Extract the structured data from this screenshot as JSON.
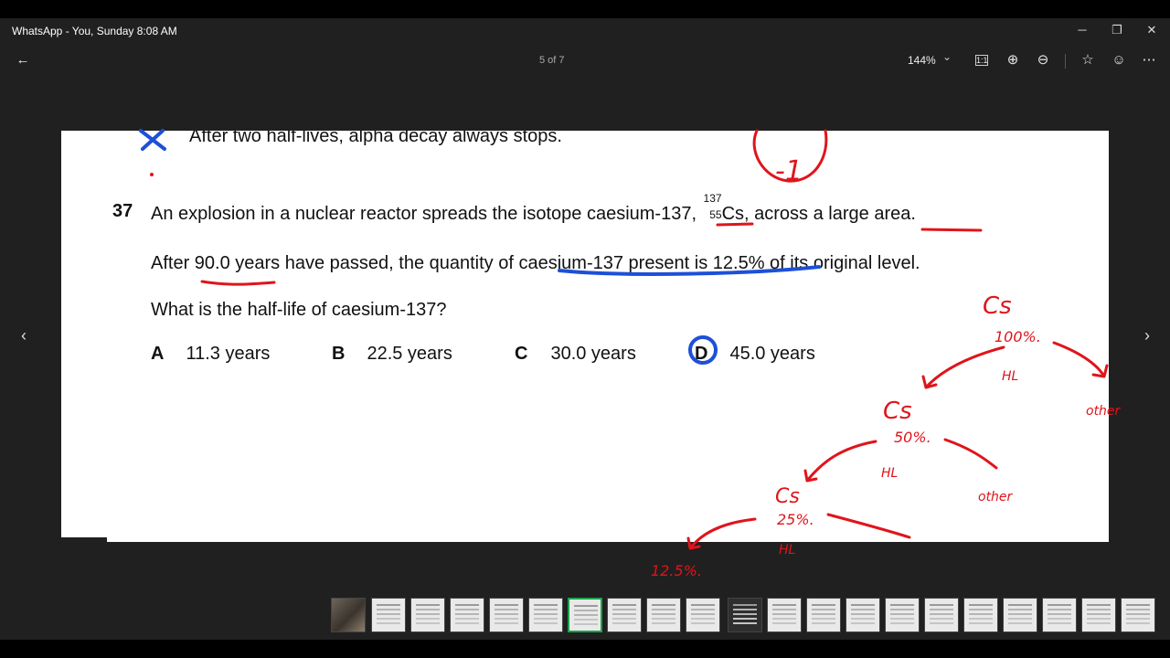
{
  "window": {
    "title": "WhatsApp - You, Sunday 8:08 AM",
    "minimize": "─",
    "restore": "❐",
    "close": "✕"
  },
  "toolbar": {
    "back_icon": "←",
    "page_counter": "5 of 7",
    "zoom_level": "144%",
    "zoom_chevron": "⌄",
    "actual_size_icon": "1:1",
    "zoom_in_icon": "⊕",
    "zoom_out_icon": "⊖",
    "favorite_icon": "☆",
    "react_icon": "☺",
    "more_icon": "⋯"
  },
  "nav": {
    "prev": "‹",
    "next": "›"
  },
  "document": {
    "prev_option_text": "After two half-lives, alpha decay always stops.",
    "question_number": "37",
    "question_line1_before": "An explosion in a nuclear reactor spreads the isotope caesium-137, ",
    "isotope_mass": "137",
    "isotope_atomic": "55",
    "isotope_symbol": "Cs",
    "question_line1_after": ", across a large area.",
    "question_line2": "After 90.0 years have passed, the quantity of caesium-137 present is 12.5% of its original level.",
    "question_line3": "What is the half-life of caesium-137?",
    "options": [
      {
        "letter": "A",
        "text": "11.3 years"
      },
      {
        "letter": "B",
        "text": "22.5 years"
      },
      {
        "letter": "C",
        "text": "30.0 years"
      },
      {
        "letter": "D",
        "text": "45.0 years"
      }
    ]
  },
  "annotations": {
    "mark": "-1",
    "cs_label": "Cs",
    "level1": "100%.",
    "level2": "50%.",
    "level3": "25%.",
    "level4": "12.5%.",
    "half_life": "HL",
    "other": "other"
  },
  "colors": {
    "ink_red": "#e0141b",
    "ink_blue": "#1d4fd8",
    "active_thumb": "#1aa34a"
  },
  "thumbnails": {
    "count": 21,
    "active_index": 6
  }
}
